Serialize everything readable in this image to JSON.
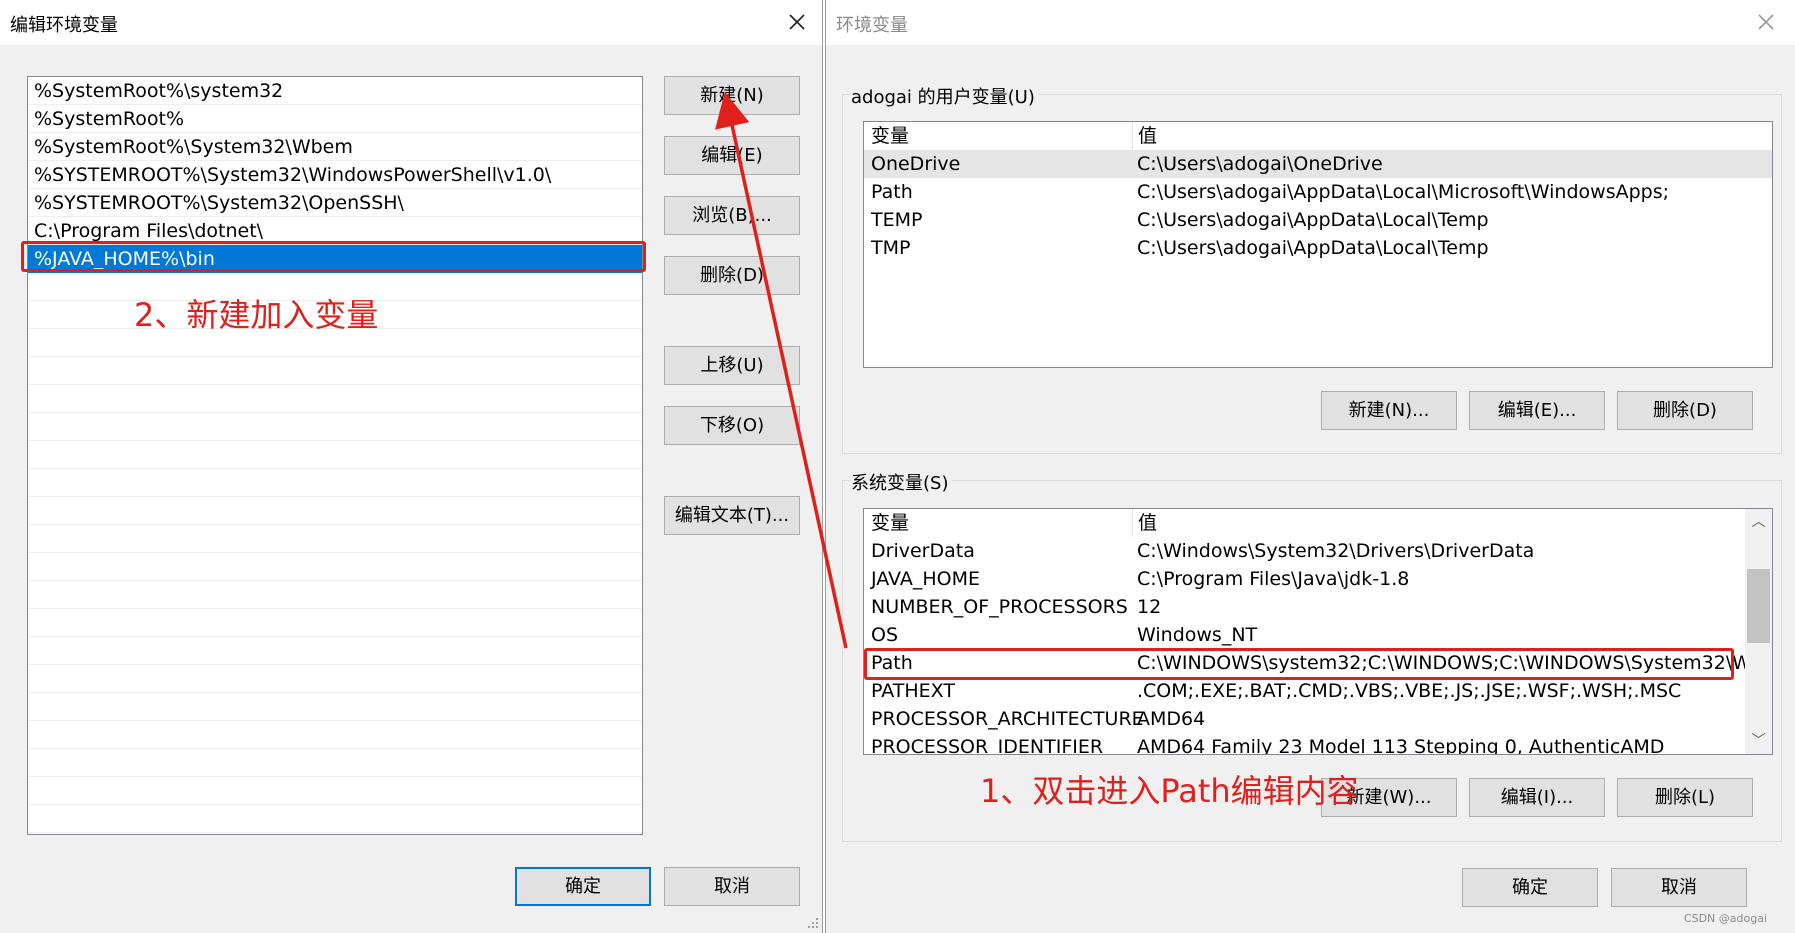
{
  "edit_dialog": {
    "title": "编辑环境变量",
    "path_entries": [
      "%SystemRoot%\\system32",
      "%SystemRoot%",
      "%SystemRoot%\\System32\\Wbem",
      "%SYSTEMROOT%\\System32\\WindowsPowerShell\\v1.0\\",
      "%SYSTEMROOT%\\System32\\OpenSSH\\",
      "C:\\Program Files\\dotnet\\",
      "%JAVA_HOME%\\bin"
    ],
    "selected_entry": "%JAVA_HOME%\\bin",
    "buttons": {
      "new": "新建(N)",
      "edit": "编辑(E)",
      "browse": "浏览(B)...",
      "delete": "删除(D)",
      "move_up": "上移(U)",
      "move_down": "下移(O)",
      "edit_text": "编辑文本(T)...",
      "ok": "确定",
      "cancel": "取消"
    }
  },
  "env_dialog": {
    "title": "环境变量",
    "user_vars_label": "adogai 的用户变量(U)",
    "user_vars_header": {
      "name": "变量",
      "value": "值"
    },
    "user_vars": [
      {
        "name": "OneDrive",
        "value": "C:\\Users\\adogai\\OneDrive"
      },
      {
        "name": "Path",
        "value": "C:\\Users\\adogai\\AppData\\Local\\Microsoft\\WindowsApps;"
      },
      {
        "name": "TEMP",
        "value": "C:\\Users\\adogai\\AppData\\Local\\Temp"
      },
      {
        "name": "TMP",
        "value": "C:\\Users\\adogai\\AppData\\Local\\Temp"
      }
    ],
    "user_buttons": {
      "new": "新建(N)...",
      "edit": "编辑(E)...",
      "delete": "删除(D)"
    },
    "system_vars_label": "系统变量(S)",
    "system_vars_header": {
      "name": "变量",
      "value": "值"
    },
    "system_vars": [
      {
        "name": "DriverData",
        "value": "C:\\Windows\\System32\\Drivers\\DriverData"
      },
      {
        "name": "JAVA_HOME",
        "value": "C:\\Program Files\\Java\\jdk-1.8"
      },
      {
        "name": "NUMBER_OF_PROCESSORS",
        "value": "12"
      },
      {
        "name": "OS",
        "value": "Windows_NT"
      },
      {
        "name": "Path",
        "value": "C:\\WINDOWS\\system32;C:\\WINDOWS;C:\\WINDOWS\\System32\\W..."
      },
      {
        "name": "PATHEXT",
        "value": ".COM;.EXE;.BAT;.CMD;.VBS;.VBE;.JS;.JSE;.WSF;.WSH;.MSC"
      },
      {
        "name": "PROCESSOR_ARCHITECTURE",
        "value": "AMD64"
      },
      {
        "name": "PROCESSOR_IDENTIFIER",
        "value": "AMD64 Family 23 Model 113 Stepping 0, AuthenticAMD"
      }
    ],
    "system_buttons": {
      "new": "新建(W)...",
      "edit": "编辑(I)...",
      "delete": "删除(L)"
    },
    "ok": "确定",
    "cancel": "取消"
  },
  "annotations": {
    "step1": "1、双击进入Path编辑内容",
    "step2": "2、新建加入变量",
    "color": "#e0201a"
  },
  "watermark": "CSDN @adogai",
  "icons": [
    "close-icon",
    "chevron-up-icon",
    "chevron-down-icon",
    "resize-grip-icon"
  ]
}
